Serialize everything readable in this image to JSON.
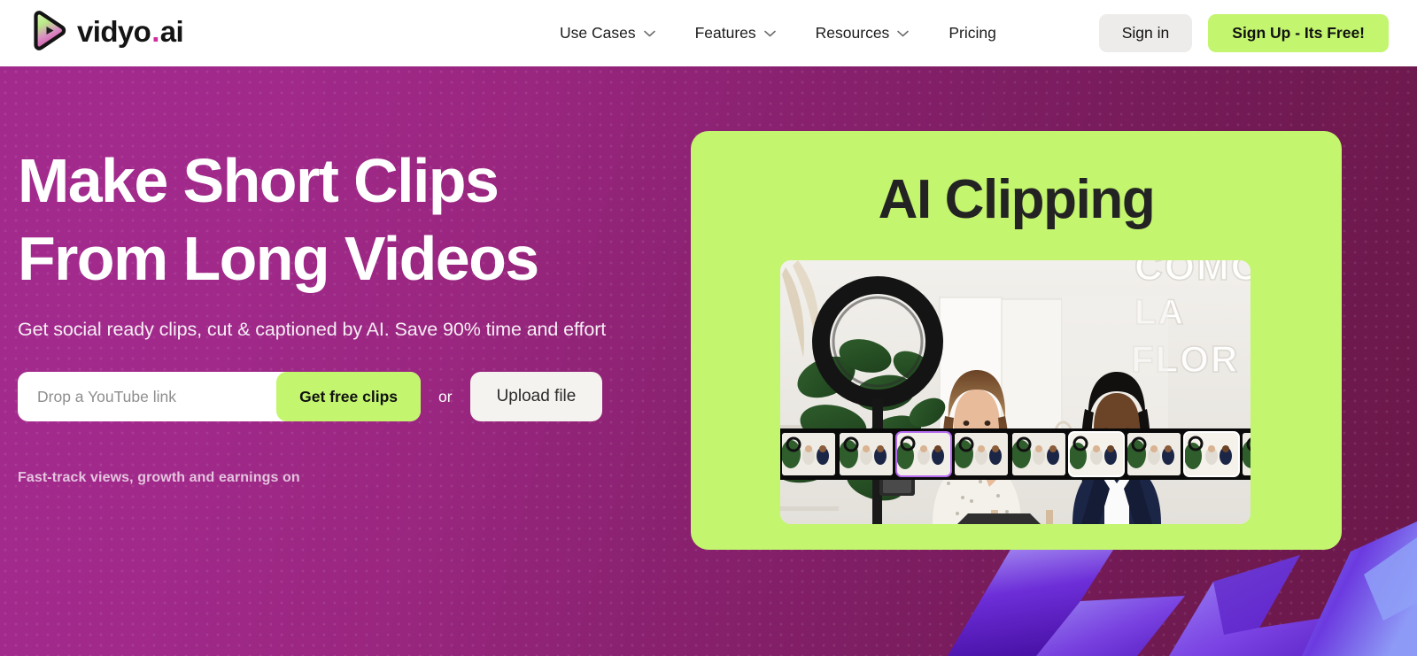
{
  "brand": {
    "name_main": "vidyo",
    "name_dot": ".",
    "name_suffix": "ai",
    "logo_icon": "play-triangle-gradient-icon",
    "logo_gradient_top": "#b7e98a",
    "logo_gradient_bottom": "#d95ab0",
    "dot_color": "#cf2f9c"
  },
  "header": {
    "nav": [
      {
        "label": "Use Cases",
        "has_dropdown": true,
        "icon": "chevron-down-icon"
      },
      {
        "label": "Features",
        "has_dropdown": true,
        "icon": "chevron-down-icon"
      },
      {
        "label": "Resources",
        "has_dropdown": true,
        "icon": "chevron-down-icon"
      },
      {
        "label": "Pricing",
        "has_dropdown": false,
        "icon": ""
      }
    ],
    "sign_in_label": "Sign in",
    "sign_up_label": "Sign Up - Its Free!",
    "sign_in_bg": "#edecea",
    "sign_up_bg": "#c3f56e"
  },
  "hero": {
    "title_line1": "Make Short Clips",
    "title_line2": "From Long Videos",
    "subtitle": "Get social ready clips, cut & captioned by AI. Save 90% time and effort",
    "input_placeholder": "Drop a YouTube link",
    "input_value": "",
    "get_clips_label": "Get free clips",
    "or_label": "or",
    "upload_label": "Upload file",
    "fast_track_label": "Fast-track views, growth and earnings on",
    "bg_gradient_from": "#a32a8d",
    "bg_gradient_to": "#6b1849",
    "accent_lime": "#c3f56e"
  },
  "promo": {
    "card_title": "AI Clipping",
    "card_bg": "#c3f56e",
    "card_title_color": "#232323",
    "video_alt": "studio-interview-two-women",
    "wall_text_line1": "COMO",
    "wall_text_line2": "LA",
    "wall_text_line3": "FLOR",
    "filmstrip": {
      "frame_count": 9,
      "selected_purple_index": 2,
      "selected_white_indices": [
        5,
        7
      ],
      "purple_border": "#b46bf0",
      "white_border": "#ffffff",
      "strip_bg": "#0a0a0a"
    }
  },
  "decoration": {
    "ribbons_alt": "3d-purple-zigzag-ribbons",
    "ribbon_light": "#8f7ef0",
    "ribbon_mid": "#6b2fd6",
    "ribbon_dark": "#4a18b0"
  }
}
